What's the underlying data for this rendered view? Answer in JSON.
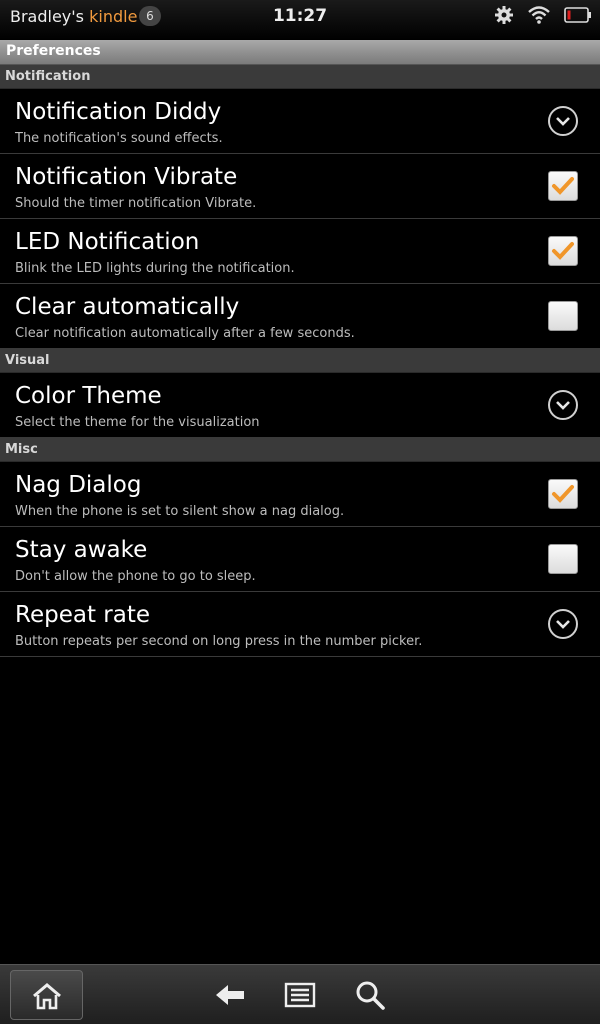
{
  "status_bar": {
    "owner_prefix": "Bradley's",
    "owner_brand": "kindle",
    "notification_count": "6",
    "time": "11:27",
    "icons": [
      "gear-icon",
      "wifi-icon",
      "battery-icon"
    ],
    "brand_color": "#f19a3e"
  },
  "title_bar": {
    "title": "Preferences"
  },
  "sections": [
    {
      "header": "Notification",
      "items": [
        {
          "title": "Notification Diddy",
          "summary": "The notification's sound effects.",
          "widget": "dropdown"
        },
        {
          "title": "Notification Vibrate",
          "summary": "Should the timer notification Vibrate.",
          "widget": "checkbox",
          "checked": true
        },
        {
          "title": "LED Notification",
          "summary": "Blink the LED lights during the notification.",
          "widget": "checkbox",
          "checked": true
        },
        {
          "title": "Clear automatically",
          "summary": "Clear notification automatically after a few seconds.",
          "widget": "checkbox",
          "checked": false
        }
      ]
    },
    {
      "header": "Visual",
      "items": [
        {
          "title": "Color Theme",
          "summary": "Select the theme for the visualization",
          "widget": "dropdown"
        }
      ]
    },
    {
      "header": "Misc",
      "items": [
        {
          "title": "Nag Dialog",
          "summary": "When the phone is set to silent show a nag dialog.",
          "widget": "checkbox",
          "checked": true
        },
        {
          "title": "Stay awake",
          "summary": "Don't allow the phone to go to sleep.",
          "widget": "checkbox",
          "checked": false
        },
        {
          "title": "Repeat rate",
          "summary": "Button repeats per second on long press in the number picker.",
          "widget": "dropdown"
        }
      ]
    }
  ],
  "bottom_bar": {
    "icons": [
      "home-icon",
      "back-icon",
      "menu-icon",
      "search-icon"
    ]
  },
  "colors": {
    "check": "#f0962a",
    "background": "#000000"
  }
}
